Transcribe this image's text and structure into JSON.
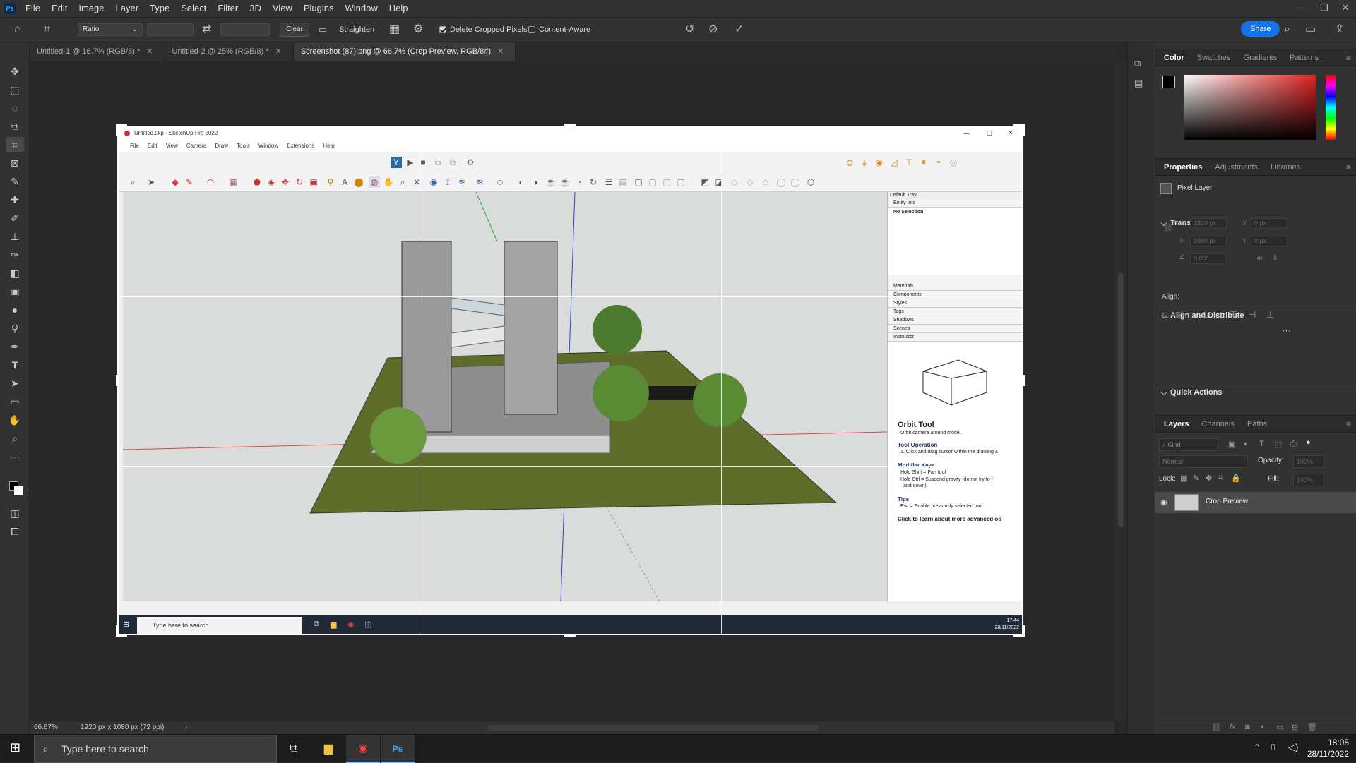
{
  "app": {
    "logo": "Ps"
  },
  "menu": [
    "File",
    "Edit",
    "Image",
    "Layer",
    "Type",
    "Select",
    "Filter",
    "3D",
    "View",
    "Plugins",
    "Window",
    "Help"
  ],
  "options": {
    "ratio_label": "Ratio",
    "clear_label": "Clear",
    "straighten_label": "Straighten",
    "delete_cropped": "Delete Cropped Pixels",
    "content_aware": "Content-Aware",
    "share_label": "Share"
  },
  "tabs": [
    {
      "label": "Untitled-1 @ 16.7% (RGB/8) *"
    },
    {
      "label": "Untitled-2 @ 25% (RGB/8) *"
    },
    {
      "label": "Screenshot (87).png @ 66.7% (Crop Preview, RGB/8#)"
    }
  ],
  "status": {
    "zoom": "66.67%",
    "doc_info": "1920 px x 1080 px (72 ppi)"
  },
  "sketchup": {
    "title": "Untitled.skp - SketchUp Pro 2022",
    "menu": [
      "File",
      "Edit",
      "View",
      "Camera",
      "Draw",
      "Tools",
      "Window",
      "Extensions",
      "Help"
    ],
    "tray": {
      "title": "Default Tray",
      "entity_info": "Entity Info",
      "no_selection": "No Selection",
      "sections": [
        "Materials",
        "Components",
        "Styles",
        "Tags",
        "Shadows",
        "Scenes",
        "Instructor"
      ]
    },
    "instructor": {
      "title": "Orbit Tool",
      "subtitle": "Orbit camera around model.",
      "op_head": "Tool Operation",
      "op_1": "1. Click and drag cursor within the drawing a",
      "mod_head": "Modifier Keys",
      "mod_1": "Hold Shift = Pan tool",
      "mod_2": "Hold Ctrl = Suspend gravity (do not try to f",
      "mod_3": "and down).",
      "tips_head": "Tips",
      "tips_1": "Esc = Enable previously selected tool.",
      "learn_more": "Click to learn about more advanced op"
    },
    "taskbar": {
      "search": "Type here to search",
      "time": "17:44",
      "date": "28/11/2022"
    }
  },
  "panels": {
    "color_tabs": [
      "Color",
      "Swatches",
      "Gradients",
      "Patterns"
    ],
    "props_tabs": [
      "Properties",
      "Adjustments",
      "Libraries"
    ],
    "pixel_layer": "Pixel Layer",
    "transform": "Transform",
    "w": "1920 px",
    "h": "1080 px",
    "x": "0 px",
    "y": "0 px",
    "angle": "0.00°",
    "w_label": "W",
    "h_label": "H",
    "x_label": "X",
    "y_label": "Y",
    "align_distribute": "Align and Distribute",
    "align": "Align:",
    "quick_actions": "Quick Actions",
    "layer_tabs": [
      "Layers",
      "Channels",
      "Paths"
    ],
    "kind": "Kind",
    "blend": "Normal",
    "opacity_label": "Opacity:",
    "opacity": "100%",
    "lock_label": "Lock:",
    "fill_label": "Fill:",
    "fill": "100%",
    "layer_name": "Crop Preview"
  },
  "taskbar": {
    "search": "Type here to search",
    "time": "18:05",
    "date": "28/11/2022"
  }
}
